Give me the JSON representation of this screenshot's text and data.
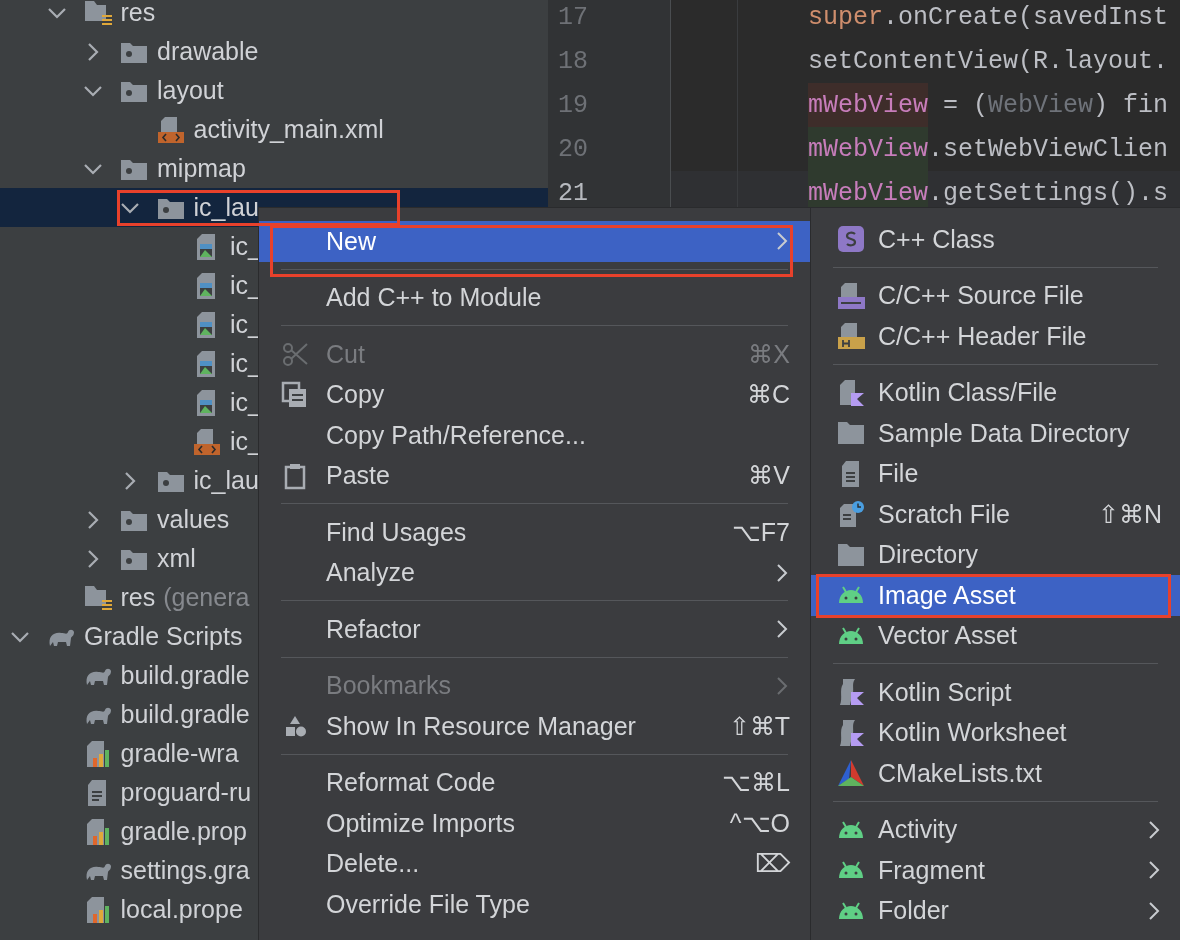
{
  "tree": [
    {
      "children": [
        {
          "label": "res",
          "kind": "res-folder",
          "selected": false,
          "expanded": true,
          "children": [
            {
              "label": "drawable",
              "kind": "folder",
              "selected": false,
              "expanded": false
            },
            {
              "label": "layout",
              "kind": "folder",
              "selected": false,
              "expanded": true,
              "children": [
                {
                  "label": "activity_main.xml",
                  "kind": "xml-file",
                  "selected": false
                }
              ]
            },
            {
              "label": "mipmap",
              "kind": "folder",
              "selected": false,
              "expanded": true,
              "children": [
                {
                  "label": "ic_lau",
                  "kind": "folder",
                  "selected": true,
                  "expanded": true,
                  "children": [
                    {
                      "label": "ic_",
                      "kind": "image-file",
                      "selected": false
                    },
                    {
                      "label": "ic_",
                      "kind": "image-file",
                      "selected": false
                    },
                    {
                      "label": "ic_",
                      "kind": "image-file",
                      "selected": false
                    },
                    {
                      "label": "ic_",
                      "kind": "image-file",
                      "selected": false
                    },
                    {
                      "label": "ic_",
                      "kind": "image-file",
                      "selected": false
                    },
                    {
                      "label": "ic_",
                      "kind": "xml-file",
                      "selected": false
                    }
                  ]
                },
                {
                  "label": "ic_lau",
                  "kind": "folder",
                  "selected": false,
                  "expanded": false
                }
              ]
            },
            {
              "label": "values",
              "kind": "folder",
              "selected": false,
              "expanded": false
            },
            {
              "label": "xml",
              "kind": "folder",
              "selected": false,
              "expanded": false
            }
          ]
        },
        {
          "label": "res",
          "note": "(genera",
          "kind": "res-folder",
          "selected": false
        }
      ]
    },
    {
      "label": "Gradle Scripts",
      "kind": "gradle",
      "selected": false,
      "expanded": true,
      "children": [
        {
          "label": "build.gradle",
          "kind": "gradle",
          "selected": false
        },
        {
          "label": "build.gradle",
          "kind": "gradle",
          "selected": false
        },
        {
          "label": "gradle-wra",
          "kind": "chart-file",
          "selected": false
        },
        {
          "label": "proguard-ru",
          "kind": "text-file",
          "selected": false
        },
        {
          "label": "gradle.prop",
          "kind": "chart-file",
          "selected": false
        },
        {
          "label": "settings.gra",
          "kind": "gradle",
          "selected": false
        },
        {
          "label": "local.prope",
          "kind": "chart-file",
          "selected": false
        }
      ]
    }
  ],
  "editor": {
    "lines": [
      {
        "number": "17",
        "current": false,
        "tokens": [
          {
            "kind": "keyword",
            "text": "super"
          },
          {
            "kind": "plain",
            "text": ".onCreate(savedInst"
          }
        ]
      },
      {
        "number": "18",
        "current": false,
        "tokens": [
          {
            "kind": "plain",
            "text": "setContentView(R.layout."
          }
        ]
      },
      {
        "number": "19",
        "current": false,
        "tokens": [
          {
            "kind": "field-write",
            "text": "mWebView"
          },
          {
            "kind": "plain",
            "text": " = ("
          },
          {
            "kind": "muted",
            "text": "WebView"
          },
          {
            "kind": "plain",
            "text": ") fin"
          }
        ]
      },
      {
        "number": "20",
        "current": false,
        "tokens": [
          {
            "kind": "field-read",
            "text": "mWebView"
          },
          {
            "kind": "plain",
            "text": ".setWebViewClien"
          }
        ]
      },
      {
        "number": "21",
        "current": true,
        "tokens": [
          {
            "kind": "field-read",
            "text": "mWebView"
          },
          {
            "kind": "plain",
            "text": ".getSettings().s"
          }
        ]
      }
    ]
  },
  "context_menu": [
    {
      "kind": "item",
      "label": "New",
      "selected": true,
      "disabled": false,
      "submenu": true
    },
    {
      "kind": "separator"
    },
    {
      "kind": "item",
      "label": "Add C++ to Module",
      "selected": false,
      "disabled": false,
      "submenu": false
    },
    {
      "kind": "separator"
    },
    {
      "kind": "item",
      "label": "Cut",
      "shortcut": "⌘X",
      "selected": false,
      "disabled": true,
      "submenu": false
    },
    {
      "kind": "item",
      "label": "Copy",
      "shortcut": "⌘C",
      "selected": false,
      "disabled": false,
      "submenu": false
    },
    {
      "kind": "item",
      "label": "Copy Path/Reference...",
      "selected": false,
      "disabled": false,
      "submenu": false
    },
    {
      "kind": "item",
      "label": "Paste",
      "shortcut": "⌘V",
      "selected": false,
      "disabled": false,
      "submenu": false
    },
    {
      "kind": "separator"
    },
    {
      "kind": "item",
      "label": "Find Usages",
      "shortcut": "⌥F7",
      "selected": false,
      "disabled": false,
      "submenu": false
    },
    {
      "kind": "item",
      "label": "Analyze",
      "selected": false,
      "disabled": false,
      "submenu": true
    },
    {
      "kind": "separator"
    },
    {
      "kind": "item",
      "label": "Refactor",
      "selected": false,
      "disabled": false,
      "submenu": true
    },
    {
      "kind": "separator"
    },
    {
      "kind": "item",
      "label": "Bookmarks",
      "selected": false,
      "disabled": true,
      "submenu": true
    },
    {
      "kind": "item",
      "label": "Show In Resource Manager",
      "shortcut": "⇧⌘T",
      "selected": false,
      "disabled": false,
      "submenu": false
    },
    {
      "kind": "separator"
    },
    {
      "kind": "item",
      "label": "Reformat Code",
      "shortcut": "⌥⌘L",
      "selected": false,
      "disabled": false,
      "submenu": false
    },
    {
      "kind": "item",
      "label": "Optimize Imports",
      "shortcut": "^⌥O",
      "selected": false,
      "disabled": false,
      "submenu": false
    },
    {
      "kind": "item",
      "label": "Delete...",
      "shortcut": "⌦",
      "selected": false,
      "disabled": false,
      "submenu": false
    },
    {
      "kind": "item",
      "label": "Override File Type",
      "selected": false,
      "disabled": false,
      "submenu": false
    }
  ],
  "submenu": [
    {
      "kind": "item",
      "label": "C++ Class",
      "selected": false,
      "submenu": false
    },
    {
      "kind": "separator"
    },
    {
      "kind": "item",
      "label": "C/C++ Source File",
      "selected": false,
      "submenu": false
    },
    {
      "kind": "item",
      "label": "C/C++ Header File",
      "selected": false,
      "submenu": false
    },
    {
      "kind": "separator"
    },
    {
      "kind": "item",
      "label": "Kotlin Class/File",
      "selected": false,
      "submenu": false
    },
    {
      "kind": "item",
      "label": "Sample Data Directory",
      "selected": false,
      "submenu": false
    },
    {
      "kind": "item",
      "label": "File",
      "selected": false,
      "submenu": false
    },
    {
      "kind": "item",
      "label": "Scratch File",
      "shortcut": "⇧⌘N",
      "selected": false,
      "submenu": false
    },
    {
      "kind": "item",
      "label": "Directory",
      "selected": false,
      "submenu": false
    },
    {
      "kind": "item",
      "label": "Image Asset",
      "selected": true,
      "submenu": false
    },
    {
      "kind": "item",
      "label": "Vector Asset",
      "selected": false,
      "submenu": false
    },
    {
      "kind": "separator"
    },
    {
      "kind": "item",
      "label": "Kotlin Script",
      "selected": false,
      "submenu": false
    },
    {
      "kind": "item",
      "label": "Kotlin Worksheet",
      "selected": false,
      "submenu": false
    },
    {
      "kind": "item",
      "label": "CMakeLists.txt",
      "selected": false,
      "submenu": false
    },
    {
      "kind": "separator"
    },
    {
      "kind": "item",
      "label": "Activity",
      "selected": false,
      "submenu": true
    },
    {
      "kind": "item",
      "label": "Fragment",
      "selected": false,
      "submenu": true
    },
    {
      "kind": "item",
      "label": "Folder",
      "selected": false,
      "submenu": true
    }
  ],
  "callouts": [
    {
      "kind": "tree-row"
    },
    {
      "kind": "menu-item"
    },
    {
      "kind": "submenu-item"
    }
  ]
}
